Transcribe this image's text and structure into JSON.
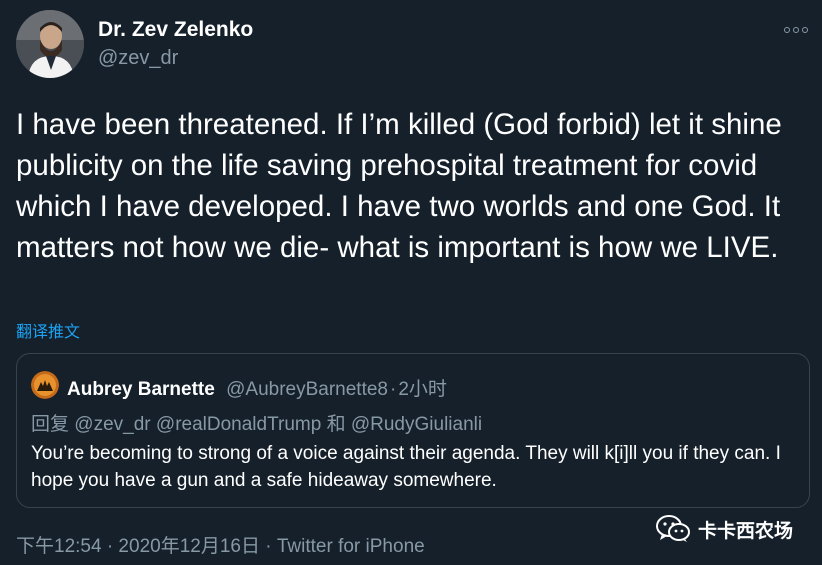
{
  "tweet": {
    "author": {
      "name": "Dr. Zev Zelenko",
      "handle": "@zev_dr"
    },
    "text": "I have been threatened. If I’m killed (God forbid) let it shine publicity on the life saving prehospital treatment for covid which I have developed. I have two worlds and one God. It matters not how we die- what is important is how we LIVE.",
    "translate_label": "翻译推文",
    "quoted": {
      "author_name": "Aubrey Barnette",
      "author_handle": "@AubreyBarnette8",
      "separator": "·",
      "time": "2小时",
      "reply_prefix": "回复",
      "reply_to_1": "@zev_dr",
      "reply_to_2": "@realDonaldTrump",
      "reply_and": "和",
      "reply_to_3": "@RudyGiulianli",
      "text": "You’re becoming to strong of a voice against their agenda. They will k[i]ll you if they can. I hope you have a gun and a safe hideaway somewhere."
    },
    "timestamp": "下午12:54 · 2020年12月16日 · ",
    "source": "Twitter for iPhone"
  },
  "watermark": {
    "text": "卡卡西农场",
    "icon": "wechat-icon"
  },
  "colors": {
    "background": "#15202b",
    "text": "#ffffff",
    "secondary": "#8899a6",
    "link": "#1da1f2",
    "border": "#38444d"
  }
}
